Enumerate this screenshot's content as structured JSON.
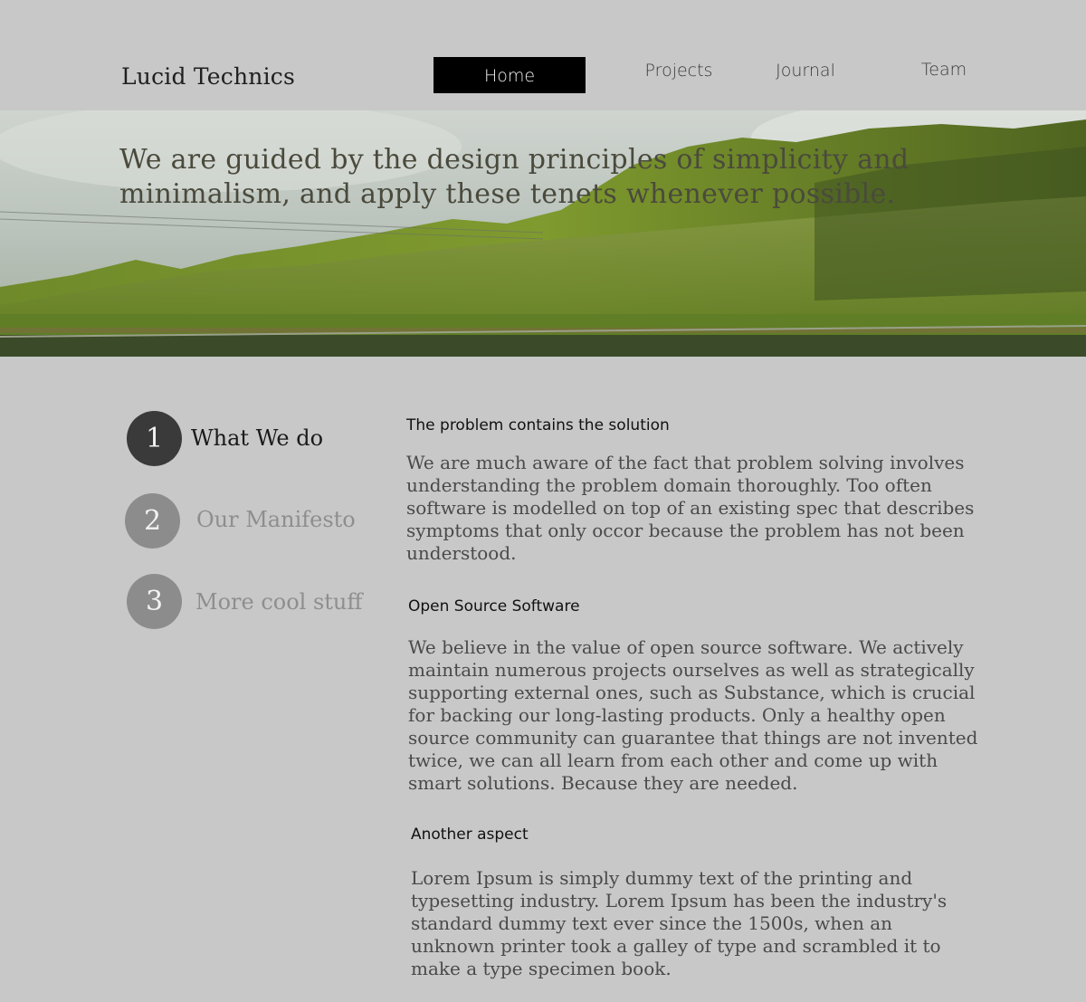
{
  "header": {
    "brand": "Lucid Technics",
    "nav": {
      "home": "Home",
      "projects": "Projects",
      "journal": "Journal",
      "team": "Team"
    }
  },
  "hero": {
    "tagline": "We are guided by the design principles of simplicity and minimalism, and apply these tenets whenever possible."
  },
  "steps": [
    {
      "number": "1",
      "label": "What We do"
    },
    {
      "number": "2",
      "label": "Our Manifesto"
    },
    {
      "number": "3",
      "label": "More cool stuff"
    }
  ],
  "sections": [
    {
      "heading": "The problem contains the solution",
      "body": "We are much aware of the fact that problem solving involves understanding the problem domain thoroughly. Too often software is modelled on top of an existing spec that describes symptoms that only occor because the problem has not been understood."
    },
    {
      "heading": "Open Source Software",
      "body": "We believe in the value of open source software. We actively maintain numerous projects ourselves as well as strategically supporting external ones, such as Substance, which is crucial for backing our long-lasting products. Only a healthy open source community can guarantee that things are not invented twice, we can all learn from each other and come up with smart solutions. Because they are needed."
    },
    {
      "heading": "Another aspect",
      "body": "Lorem Ipsum is simply dummy text of the printing and typesetting industry. Lorem Ipsum has been the industry's standard dummy text ever since the 1500s, when an unknown printer took a galley of type and scrambled it to make a type specimen book."
    }
  ]
}
